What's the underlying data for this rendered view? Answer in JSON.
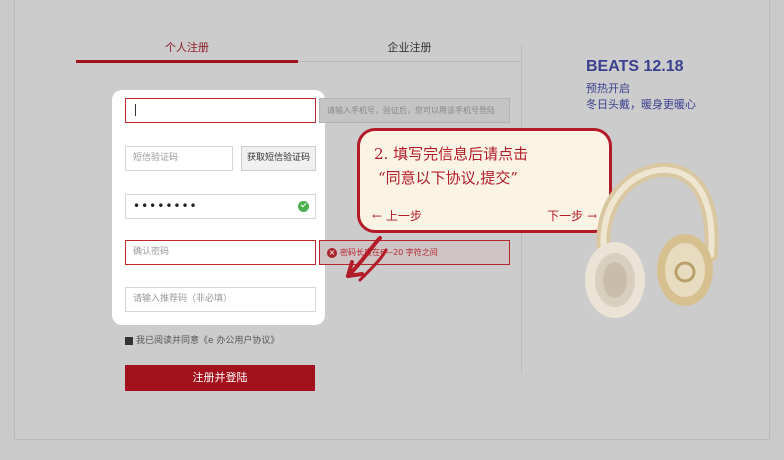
{
  "tabs": [
    {
      "label": "个人注册",
      "active": true
    },
    {
      "label": "企业注册",
      "active": false
    }
  ],
  "form": {
    "phone_value": "",
    "phone_hint": "请输入手机号，验证后，您可以用该手机号登陆",
    "sms_placeholder": "短信验证码",
    "sms_button": "获取短信验证码",
    "password_value": "••••••••",
    "confirm_placeholder": "确认密码",
    "confirm_error": "密码长度在6—20 字符之间",
    "referral_placeholder": "请输入推荐码（非必填）",
    "agree_text": "我已阅读并同意《e 办公用户协议》",
    "agree_checked": true,
    "submit_label": "注册并登陆"
  },
  "callout": {
    "line1": "2. 填写完信息后请点击",
    "line2": "“同意以下协议,提交”",
    "prev": "上一步",
    "next": "下一步"
  },
  "promo": {
    "title": "BEATS   12.18",
    "line1": "预热开启",
    "line2": "冬日头戴，暖身更暖心"
  },
  "colors": {
    "accent": "#a3121c",
    "promo_text": "#3b3f8f",
    "success": "#4caf50"
  }
}
